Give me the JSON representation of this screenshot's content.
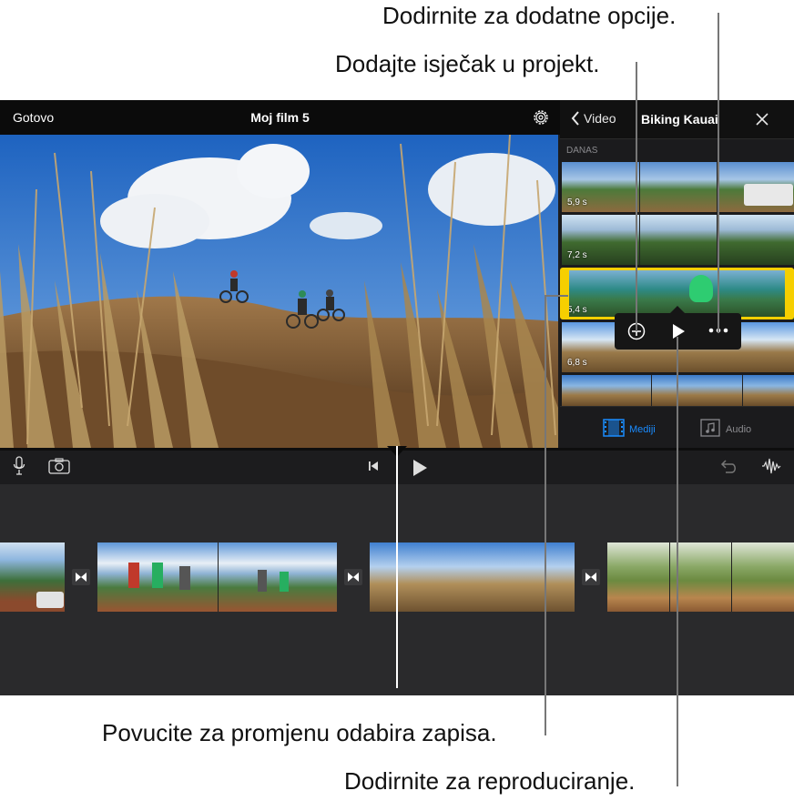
{
  "callouts": {
    "more_options": "Dodirnite za dodatne opcije.",
    "add_clip": "Dodajte isječak u projekt.",
    "drag_selection": "Povucite za promjenu odabira zapisa.",
    "tap_play": "Dodirnite za reproduciranje."
  },
  "viewer": {
    "done_label": "Gotovo",
    "project_title": "Moj film 5"
  },
  "browser": {
    "back_label": "Video",
    "title": "Biking Kauai",
    "section_label": "DANAS",
    "clips": [
      {
        "duration": "5,9 s"
      },
      {
        "duration": "7,2 s"
      },
      {
        "duration": "5,4 s",
        "selected": true
      },
      {
        "duration": "6,8 s"
      },
      {
        "duration": ""
      }
    ],
    "tabs": {
      "media": "Mediji",
      "audio": "Audio"
    }
  },
  "colors": {
    "accent": "#1a8cff",
    "selection": "#f6cf00"
  }
}
